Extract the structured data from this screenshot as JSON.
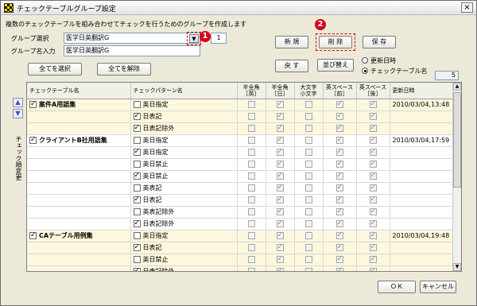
{
  "window": {
    "title": "チェックテーブルグループ設定",
    "close_label": "×"
  },
  "description": "複数のチェックテーブルを組み合わせてチェックを行うためのグループを作成します",
  "group_select": {
    "label": "グループ選択",
    "value": "医学日英翻訳G",
    "dropdown_glyph": "▼",
    "marker": "1",
    "count": "1"
  },
  "group_name": {
    "label": "グループ名入力",
    "value": "医学日英翻訳G"
  },
  "buttons": {
    "select_all": "全てを選択",
    "deselect_all": "全てを解除",
    "new": "新 規",
    "delete": "削 除",
    "save": "保 存",
    "back": "戻 す",
    "sort": "並び替え",
    "ok": "ＯＫ",
    "cancel": "キャンセル"
  },
  "delete_marker": "2",
  "sort_options": {
    "by_date": "更新日時",
    "by_name": "チェックテーブル名",
    "selected": "by_name"
  },
  "record_count": "5",
  "side": {
    "up": "▲",
    "down": "▼",
    "label": "チェック順変更"
  },
  "columns": {
    "table_name": "チェックテーブル名",
    "pattern_name": "チェックパターン名",
    "half_full_en": [
      "半全角",
      "［英］"
    ],
    "half_full_ja": [
      "半全角",
      "［日］"
    ],
    "upper_lower": [
      "大文字",
      "小文字"
    ],
    "space_before": [
      "英スペース",
      "［前］"
    ],
    "space_after": [
      "英スペース",
      "［後］"
    ],
    "updated": "更新日時"
  },
  "rows": [
    {
      "group": true,
      "table_checked": true,
      "table": "案件A用語集",
      "pattern_checked": false,
      "pattern": "英日指定",
      "cols": [
        false,
        true,
        false,
        true,
        true
      ],
      "updated": "2010/03/04,13:48"
    },
    {
      "group": true,
      "table_checked": null,
      "table": "",
      "pattern_checked": true,
      "pattern": "日表記",
      "cols": [
        false,
        true,
        false,
        true,
        true
      ],
      "updated": ""
    },
    {
      "group": true,
      "table_checked": null,
      "table": "",
      "pattern_checked": true,
      "pattern": "日表記除外",
      "cols": [
        false,
        true,
        false,
        true,
        true
      ],
      "updated": ""
    },
    {
      "group": false,
      "table_checked": true,
      "table": "クライアントB社用語集",
      "pattern_checked": false,
      "pattern": "英日指定",
      "cols": [
        false,
        true,
        false,
        true,
        true
      ],
      "updated": "2010/03/04,17:59"
    },
    {
      "group": false,
      "table_checked": null,
      "table": "",
      "pattern_checked": true,
      "pattern": "英日指定",
      "cols": [
        false,
        true,
        false,
        true,
        true
      ],
      "updated": ""
    },
    {
      "group": false,
      "table_checked": null,
      "table": "",
      "pattern_checked": false,
      "pattern": "英日禁止",
      "cols": [
        false,
        true,
        false,
        true,
        true
      ],
      "updated": ""
    },
    {
      "group": false,
      "table_checked": null,
      "table": "",
      "pattern_checked": true,
      "pattern": "英日禁止",
      "cols": [
        false,
        true,
        false,
        true,
        true
      ],
      "updated": ""
    },
    {
      "group": false,
      "table_checked": null,
      "table": "",
      "pattern_checked": false,
      "pattern": "英表記",
      "cols": [
        false,
        true,
        false,
        true,
        true
      ],
      "updated": ""
    },
    {
      "group": false,
      "table_checked": null,
      "table": "",
      "pattern_checked": true,
      "pattern": "日表記",
      "cols": [
        false,
        true,
        false,
        true,
        true
      ],
      "updated": ""
    },
    {
      "group": false,
      "table_checked": null,
      "table": "",
      "pattern_checked": false,
      "pattern": "英表記除外",
      "cols": [
        false,
        true,
        false,
        true,
        true
      ],
      "updated": ""
    },
    {
      "group": false,
      "table_checked": null,
      "table": "",
      "pattern_checked": true,
      "pattern": "日表記除外",
      "cols": [
        false,
        true,
        false,
        true,
        true
      ],
      "updated": ""
    },
    {
      "group": true,
      "table_checked": true,
      "table": "CAテーブル用例集",
      "pattern_checked": false,
      "pattern": "英日指定",
      "cols": [
        false,
        true,
        false,
        true,
        true
      ],
      "updated": "2010/03/04,19:48"
    },
    {
      "group": true,
      "table_checked": null,
      "table": "",
      "pattern_checked": true,
      "pattern": "日表記",
      "cols": [
        false,
        true,
        false,
        true,
        true
      ],
      "updated": ""
    },
    {
      "group": true,
      "table_checked": null,
      "table": "",
      "pattern_checked": false,
      "pattern": "英日禁止",
      "cols": [
        false,
        true,
        false,
        true,
        true
      ],
      "updated": ""
    },
    {
      "group": true,
      "table_checked": null,
      "table": "",
      "pattern_checked": true,
      "pattern": "日表記除外",
      "cols": [
        false,
        true,
        false,
        true,
        true
      ],
      "updated": ""
    }
  ],
  "colors": {
    "highlight": "#e00000",
    "group_row": "#fdf7dd"
  }
}
